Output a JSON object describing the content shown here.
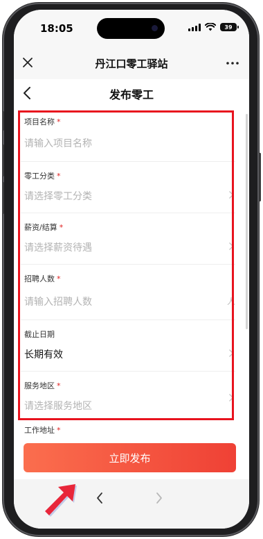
{
  "status_bar": {
    "time": "18:05",
    "battery": "39"
  },
  "mini_program": {
    "title": "丹江口零工驿站"
  },
  "page": {
    "title": "发布零工"
  },
  "form": {
    "fields": [
      {
        "label": "项目名称",
        "required": "*",
        "placeholder": "请输入项目名称",
        "control": "text-input"
      },
      {
        "label": "零工分类",
        "required": "*",
        "placeholder": "请选择零工分类",
        "control": "select"
      },
      {
        "label": "薪资/结算",
        "required": "*",
        "placeholder": "请选择薪资待遇",
        "control": "select"
      },
      {
        "label": "招聘人数",
        "required": "*",
        "placeholder": "请输入招聘人数",
        "unit": "人",
        "control": "number-input"
      },
      {
        "label": "截止日期",
        "value": "长期有效",
        "control": "select"
      },
      {
        "label": "服务地区",
        "required": "*",
        "placeholder": "请选择服务地区",
        "control": "select"
      }
    ],
    "work_address": {
      "label": "工作地址",
      "required": "*"
    }
  },
  "actions": {
    "submit_label": "立即发布"
  },
  "colors": {
    "accent_start": "#fb6e4e",
    "accent_end": "#ef4135",
    "required": "#e02020",
    "highlight_box": "#e8131e",
    "pointer_arrow": "#e8263a"
  }
}
